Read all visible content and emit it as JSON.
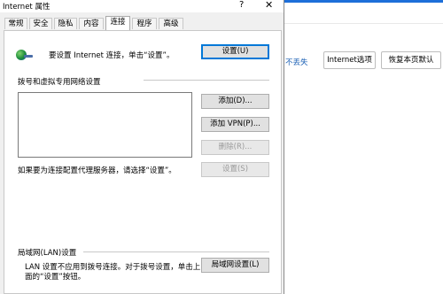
{
  "background": {
    "link_text": "不丢失",
    "buttons": [
      "Internet选项",
      "恢复本页默认"
    ]
  },
  "dialog": {
    "title": "Internet 属性",
    "help_glyph": "?",
    "close_glyph": "✕",
    "tabs": [
      "常规",
      "安全",
      "隐私",
      "内容",
      "连接",
      "程序",
      "高级"
    ],
    "active_tab": "连接",
    "setup_text": "要设置 Internet 连接，单击“设置”。",
    "setup_button": "设置(U)",
    "dialup_group": "拨号和虚拟专用网络设置",
    "add_button": "添加(D)...",
    "add_vpn_button": "添加 VPN(P)...",
    "delete_button": "删除(R)...",
    "proxy_text": "如果要为连接配置代理服务器，请选择“设置”。",
    "settings_button": "设置(S)",
    "lan_group": "局域网(LAN)设置",
    "lan_text_line1": "LAN 设置不应用到拨号连接。对于拨号设置，单击上",
    "lan_text_line2": "面的“设置”按钮。",
    "lan_button": "局域网设置(L)"
  }
}
